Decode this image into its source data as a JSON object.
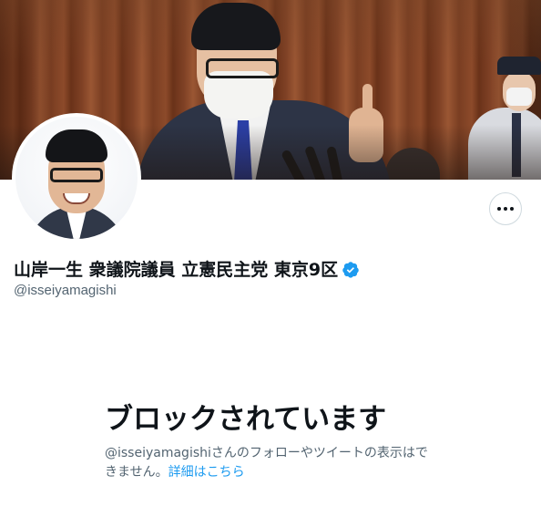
{
  "profile": {
    "display_name": "山岸一生 衆議院議員 立憲民主党 東京9区",
    "handle": "@isseiyamagishi",
    "verified": true
  },
  "icons": {
    "more": "more-horizontal-icon",
    "verified": "verified-badge-icon"
  },
  "blocked": {
    "title": "ブロックされています",
    "message": "@isseiyamagishiさんのフォローやツイートの表示はできません。",
    "learn_more": "詳細はこちら"
  },
  "colors": {
    "accent": "#1d9bf0",
    "text_primary": "#0f1419",
    "text_secondary": "#536471"
  }
}
